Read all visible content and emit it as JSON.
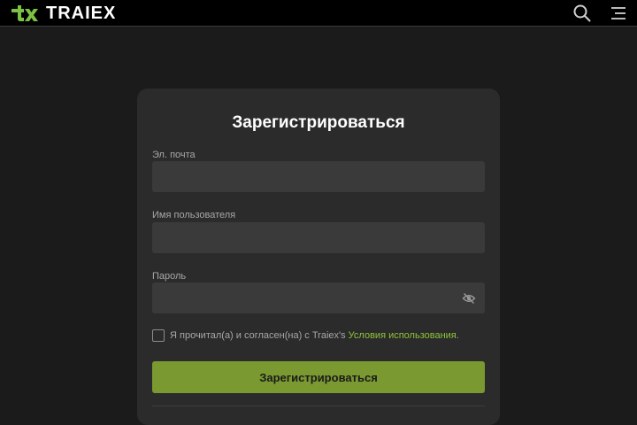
{
  "header": {
    "logo_text": "TRAIEX",
    "logo_mark_icon": "tx-logo-mark",
    "search_icon": "search-icon",
    "menu_icon": "hamburger-menu-icon"
  },
  "form": {
    "title": "Зарегистрироваться",
    "email": {
      "label": "Эл. почта",
      "value": "",
      "placeholder": ""
    },
    "username": {
      "label": "Имя пользователя",
      "value": "",
      "placeholder": ""
    },
    "password": {
      "label": "Пароль",
      "value": "",
      "placeholder": "",
      "toggle_icon": "eye-off-icon"
    },
    "agree": {
      "checked": false,
      "text": "Я прочитал(а) и согласен(на) с Traiex's ",
      "link": "Условия использования",
      "suffix": "."
    },
    "submit_label": "Зарегистрироваться"
  },
  "colors": {
    "accent": "#7a9a31",
    "link": "#8fc43a",
    "logo_green": "#7cc242",
    "background": "#1b1b1b",
    "card": "#2b2b2b",
    "input": "#3a3a3a"
  }
}
